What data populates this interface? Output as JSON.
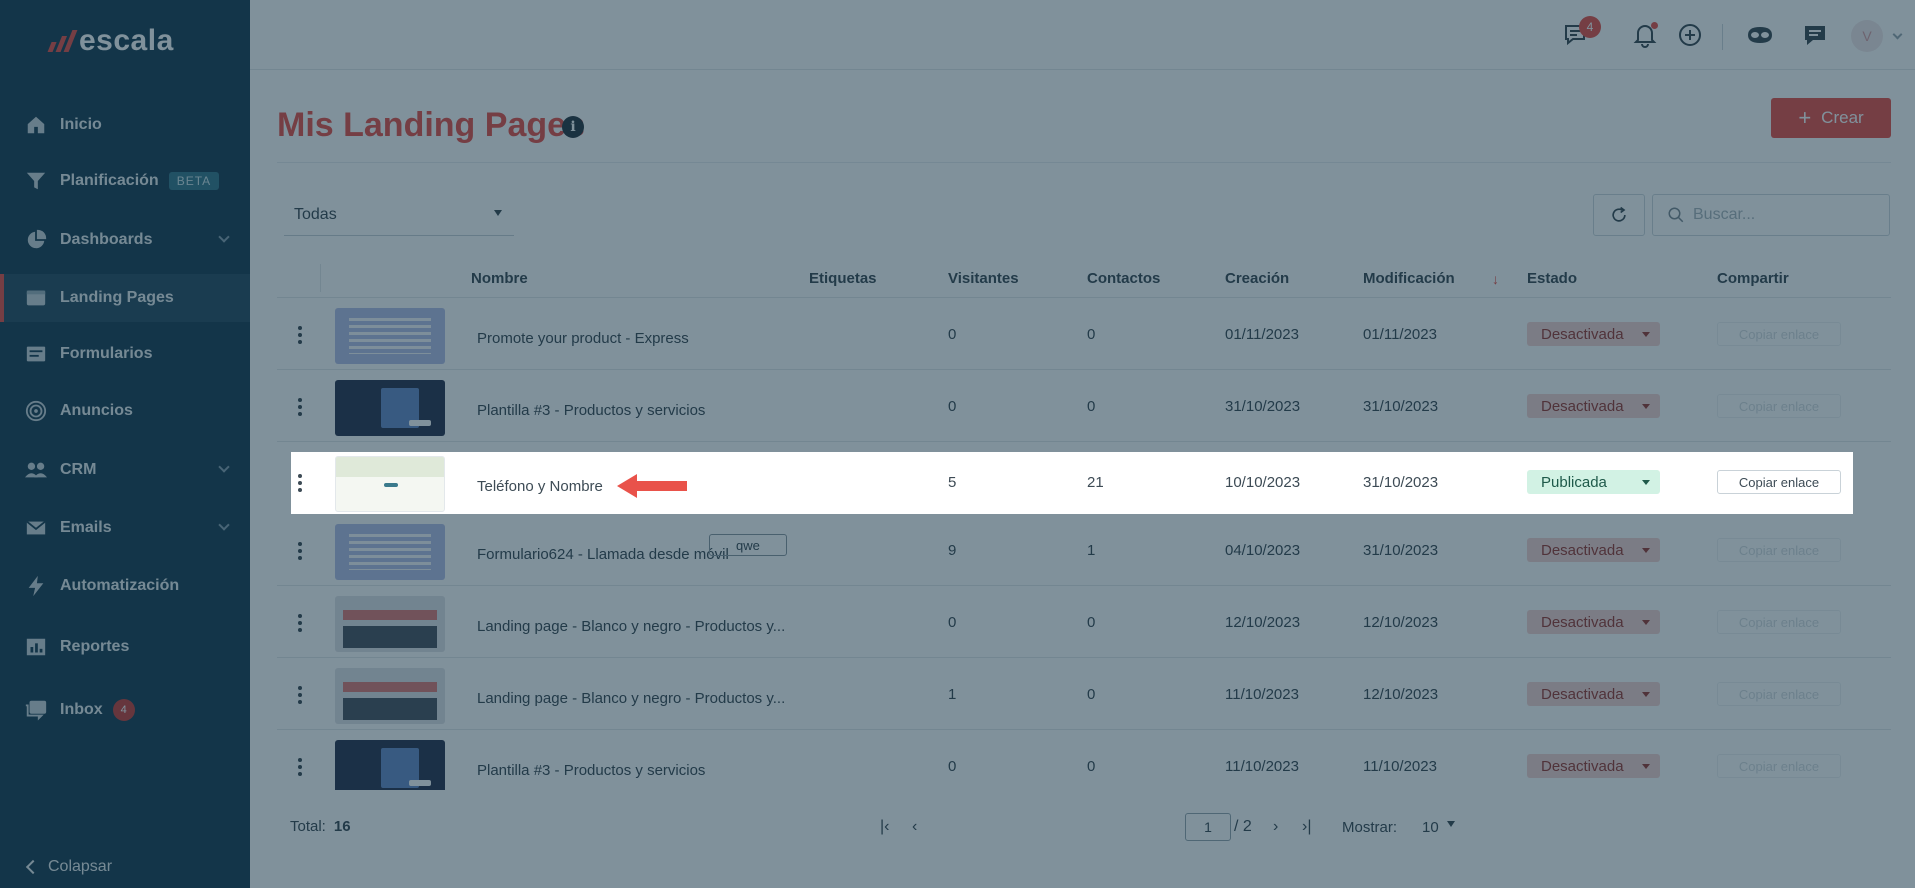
{
  "brand": {
    "name": "escala"
  },
  "sidebar": {
    "items": [
      {
        "label": "Inicio",
        "icon": "home-icon"
      },
      {
        "label": "Planificación",
        "icon": "funnel-icon",
        "badge": "BETA"
      },
      {
        "label": "Dashboards",
        "icon": "pie-chart-icon"
      },
      {
        "label": "Landing Pages",
        "icon": "browser-window-icon"
      },
      {
        "label": "Formularios",
        "icon": "form-icon"
      },
      {
        "label": "Anuncios",
        "icon": "target-icon"
      },
      {
        "label": "CRM",
        "icon": "people-icon"
      },
      {
        "label": "Emails",
        "icon": "envelope-icon"
      },
      {
        "label": "Automatización",
        "icon": "lightning-icon"
      },
      {
        "label": "Reportes",
        "icon": "report-icon"
      },
      {
        "label": "Inbox",
        "icon": "inbox-icon",
        "badge": "4"
      }
    ],
    "active": "Landing Pages",
    "collapse_label": "Colapsar"
  },
  "topbar": {
    "chat_badge": "4",
    "avatar_initial": "V"
  },
  "page": {
    "title": "Mis Landing Pages",
    "create_label": "Crear",
    "filter_value": "Todas",
    "search_placeholder": "Buscar..."
  },
  "table": {
    "headers": [
      "Nombre",
      "Etiquetas",
      "Visitantes",
      "Contactos",
      "Creación",
      "Modificación",
      "Estado",
      "Compartir"
    ],
    "rows": [
      {
        "name": "Promote your product - Express",
        "tags": "",
        "visitors": "0",
        "contacts": "0",
        "created": "01/11/2023",
        "modified": "01/11/2023",
        "status": "Desactivada",
        "share": "Copiar enlace",
        "thumb": "gray"
      },
      {
        "name": "Plantilla #3 - Productos y servicios",
        "tags": "",
        "visitors": "0",
        "contacts": "0",
        "created": "31/10/2023",
        "modified": "31/10/2023",
        "status": "Desactivada",
        "share": "Copiar enlace",
        "thumb": "dark"
      },
      {
        "name": "Teléfono y Nombre",
        "tags": "",
        "visitors": "5",
        "contacts": "21",
        "created": "10/10/2023",
        "modified": "31/10/2023",
        "status": "Publicada",
        "share": "Copiar enlace",
        "thumb": "light"
      },
      {
        "name": "Formulario624 - Llamada desde móvil",
        "tags": "qwe",
        "visitors": "9",
        "contacts": "1",
        "created": "04/10/2023",
        "modified": "31/10/2023",
        "status": "Desactivada",
        "share": "Copiar enlace",
        "thumb": "gray"
      },
      {
        "name": "Landing page - Blanco y negro - Productos y...",
        "tags": "",
        "visitors": "0",
        "contacts": "0",
        "created": "12/10/2023",
        "modified": "12/10/2023",
        "status": "Desactivada",
        "share": "Copiar enlace",
        "thumb": "red"
      },
      {
        "name": "Landing page - Blanco y negro - Productos y...",
        "tags": "",
        "visitors": "1",
        "contacts": "0",
        "created": "11/10/2023",
        "modified": "12/10/2023",
        "status": "Desactivada",
        "share": "Copiar enlace",
        "thumb": "red"
      },
      {
        "name": "Plantilla #3 - Productos y servicios",
        "tags": "",
        "visitors": "0",
        "contacts": "0",
        "created": "11/10/2023",
        "modified": "11/10/2023",
        "status": "Desactivada",
        "share": "Copiar enlace",
        "thumb": "dark"
      }
    ]
  },
  "footer": {
    "total_label": "Total:",
    "total_value": "16",
    "current_page": "1",
    "total_pages": "/ 2",
    "show_label": "Mostrar:",
    "show_value": "10"
  },
  "colors": {
    "accent": "#e9524a",
    "sidebar_bg": "#1d4054",
    "published": "#d2f2e4",
    "deactivated": "#f5d4d2"
  }
}
